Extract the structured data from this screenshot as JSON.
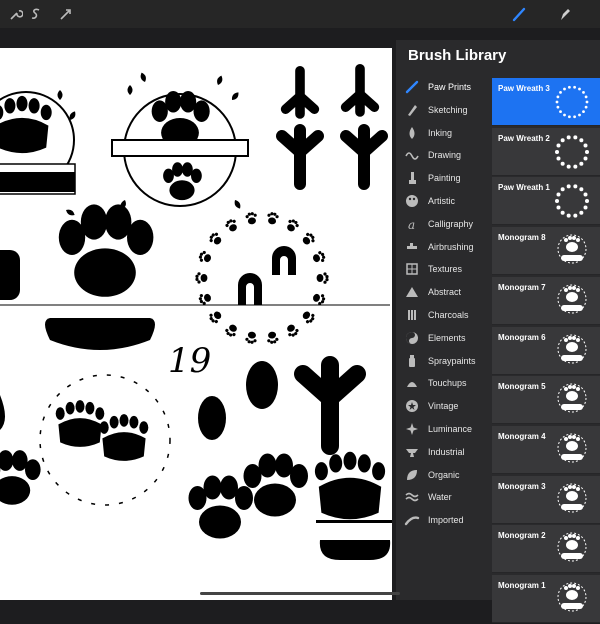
{
  "panel": {
    "title": "Brush Library",
    "categories": [
      {
        "label": "Paw Prints",
        "icon": "brush-stroke-icon"
      },
      {
        "label": "Sketching",
        "icon": "pencil-icon"
      },
      {
        "label": "Inking",
        "icon": "ink-drop-icon"
      },
      {
        "label": "Drawing",
        "icon": "squiggle-icon"
      },
      {
        "label": "Painting",
        "icon": "paint-brush-icon"
      },
      {
        "label": "Artistic",
        "icon": "palette-icon"
      },
      {
        "label": "Calligraphy",
        "icon": "calligraphy-a-icon"
      },
      {
        "label": "Airbrushing",
        "icon": "airbrush-icon"
      },
      {
        "label": "Textures",
        "icon": "texture-grid-icon"
      },
      {
        "label": "Abstract",
        "icon": "triangle-icon"
      },
      {
        "label": "Charcoals",
        "icon": "charcoal-bars-icon"
      },
      {
        "label": "Elements",
        "icon": "yin-yang-icon"
      },
      {
        "label": "Spraypaints",
        "icon": "spray-can-icon"
      },
      {
        "label": "Touchups",
        "icon": "touchup-icon"
      },
      {
        "label": "Vintage",
        "icon": "star-badge-icon"
      },
      {
        "label": "Luminance",
        "icon": "sparkle-icon"
      },
      {
        "label": "Industrial",
        "icon": "anvil-icon"
      },
      {
        "label": "Organic",
        "icon": "leaf-icon"
      },
      {
        "label": "Water",
        "icon": "waves-icon"
      },
      {
        "label": "Imported",
        "icon": "stroke-icon"
      }
    ],
    "selected_category": "Paw Prints",
    "brushes": [
      {
        "name": "Paw Wreath 3",
        "preview": "wreath-dots-preview-icon"
      },
      {
        "name": "Paw Wreath 2",
        "preview": "wreath-paws-preview-icon"
      },
      {
        "name": "Paw Wreath 1",
        "preview": "wreath-paws-preview-icon"
      },
      {
        "name": "Monogram 8",
        "preview": "monogram-paw-preview-icon"
      },
      {
        "name": "Monogram 7",
        "preview": "monogram-paw-preview-icon"
      },
      {
        "name": "Monogram 6",
        "preview": "monogram-paw-preview-icon"
      },
      {
        "name": "Monogram 5",
        "preview": "monogram-paw-preview-icon"
      },
      {
        "name": "Monogram 4",
        "preview": "monogram-paw-preview-icon"
      },
      {
        "name": "Monogram 3",
        "preview": "monogram-paw-preview-icon"
      },
      {
        "name": "Monogram 2",
        "preview": "monogram-paw-preview-icon"
      },
      {
        "name": "Monogram 1",
        "preview": "monogram-paw-preview-icon"
      }
    ],
    "selected_brush": "Paw Wreath 3"
  },
  "canvas": {
    "number_text": "19"
  },
  "colors": {
    "accent": "#1d73f2",
    "panel_bg": "#2a2a2c",
    "brush_row_bg": "#38383a"
  }
}
